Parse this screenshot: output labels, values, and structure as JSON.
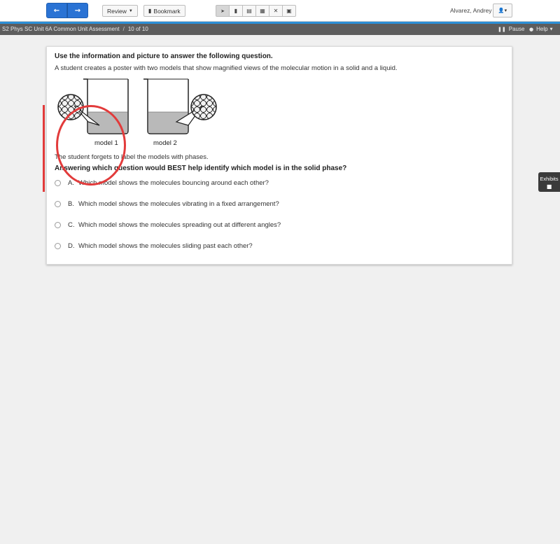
{
  "toolbar": {
    "back_icon": "←",
    "forward_icon": "→",
    "review_label": "Review",
    "bookmark_label": "Bookmark",
    "tools": [
      {
        "icon": "pointer-icon",
        "glyph": "➤"
      },
      {
        "icon": "highlighter-icon",
        "glyph": "▮"
      },
      {
        "icon": "notepad-icon",
        "glyph": "▤"
      },
      {
        "icon": "calculator-icon",
        "glyph": "▦"
      },
      {
        "icon": "cross-out-icon",
        "glyph": "✕"
      },
      {
        "icon": "note-icon",
        "glyph": "▣"
      }
    ],
    "user_name": "Alvarez, Andrey",
    "user_icon": "👤▾"
  },
  "subbar": {
    "title": "S2 Phys SC Unit 6A Common Unit Assessment",
    "separator": "/",
    "progress": "10 of 10",
    "pause_label": "Pause",
    "help_label": "Help"
  },
  "question": {
    "intro": "Use the information and picture to answer the following question.",
    "stem": "A student creates a poster with two models that show magnified views of the molecular motion in a solid and a liquid.",
    "figure": {
      "model1_label": "model 1",
      "model2_label": "model 2"
    },
    "note": "The student forgets to label the models with phases.",
    "ask": "Answering which question would BEST help identify which model is in the solid phase?",
    "options": [
      {
        "letter": "A.",
        "text": "Which model shows the molecules bouncing around each other?"
      },
      {
        "letter": "B.",
        "text": "Which model shows the molecules vibrating in a fixed arrangement?"
      },
      {
        "letter": "C.",
        "text": "Which model shows the molecules spreading out at different angles?"
      },
      {
        "letter": "D.",
        "text": "Which model shows the molecules sliding past each other?"
      }
    ]
  },
  "exhibits": {
    "label": "Exhibits"
  },
  "colors": {
    "accent": "#2b8fd6",
    "nav_blue": "#2a73d4",
    "annotation_red": "#e23b3b",
    "subbar": "#5d5d5d"
  }
}
